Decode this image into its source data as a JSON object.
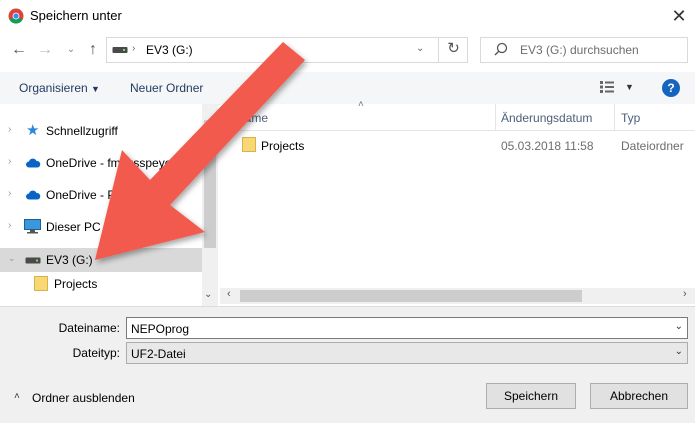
{
  "window": {
    "title": "Speichern unter"
  },
  "address": {
    "path_label": "EV3 (G:)",
    "search_placeholder": "EV3 (G:) durchsuchen"
  },
  "toolbar": {
    "organize": "Organisieren",
    "new_folder": "Neuer Ordner",
    "help": "?"
  },
  "nav": {
    "items": [
      {
        "label": "Schnellzugriff"
      },
      {
        "label": "OneDrive - fmsgsspeyer"
      },
      {
        "label": "OneDrive - Personal"
      },
      {
        "label": "Dieser PC"
      },
      {
        "label": "EV3 (G:)"
      },
      {
        "label": "Projects"
      }
    ]
  },
  "columns": {
    "name": "Name",
    "modified": "Änderungsdatum",
    "type": "Typ"
  },
  "files": [
    {
      "name": "Projects",
      "modified": "05.03.2018 11:58",
      "type": "Dateiordner"
    }
  ],
  "form": {
    "filename_label": "Dateiname:",
    "filename_value": "NEPOprog",
    "filetype_label": "Dateityp:",
    "filetype_value": "UF2-Datei"
  },
  "footer": {
    "hide_folders": "Ordner ausblenden",
    "save": "Speichern",
    "cancel": "Abbrechen"
  },
  "colors": {
    "arrow": "#f25a4e",
    "selected": "#d9d9d9",
    "folder": "#f8d775"
  }
}
